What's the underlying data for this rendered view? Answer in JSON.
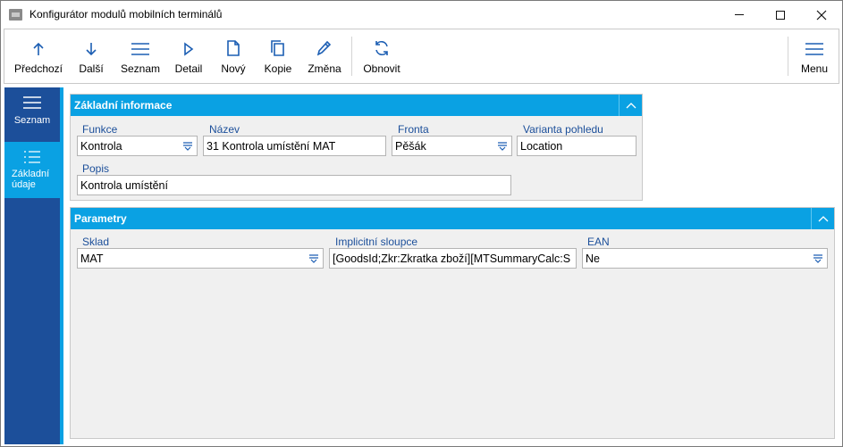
{
  "window": {
    "title": "Konfigurátor modulů mobilních terminálů",
    "icon": "app-icon",
    "controls": [
      "minimize-icon",
      "maximize-icon",
      "close-icon"
    ]
  },
  "toolbar": {
    "items": [
      {
        "label": "Předchozí",
        "icon": "arrow-up-icon"
      },
      {
        "label": "Další",
        "icon": "arrow-down-icon"
      },
      {
        "label": "Seznam",
        "icon": "list-icon"
      },
      {
        "label": "Detail",
        "icon": "play-icon"
      },
      {
        "label": "Nový",
        "icon": "new-document-icon"
      },
      {
        "label": "Kopie",
        "icon": "copy-icon"
      },
      {
        "label": "Změna",
        "icon": "pencil-icon"
      },
      {
        "label": "Obnovit",
        "icon": "refresh-icon"
      }
    ],
    "menu_label": "Menu"
  },
  "nav": {
    "items": [
      {
        "label": "Seznam",
        "icon": "list-icon"
      },
      {
        "label_line1": "Základní",
        "label_line2": "údaje",
        "icon": "details-list-icon",
        "selected": true
      }
    ]
  },
  "sections": {
    "basic": {
      "title": "Základní informace",
      "funkce_label": "Funkce",
      "funkce_value": "Kontrola",
      "nazev_label": "Název",
      "nazev_value": "31 Kontrola umístění MAT",
      "fronta_label": "Fronta",
      "fronta_value": "Pěšák",
      "varianta_label": "Varianta pohledu",
      "varianta_value": "Location",
      "popis_label": "Popis",
      "popis_value": "Kontrola umístění"
    },
    "params": {
      "title": "Parametry",
      "sklad_label": "Sklad",
      "sklad_value": "MAT",
      "sloupce_label": "Implicitní sloupce",
      "sloupce_value": "[GoodsId;Zkr:Zkratka zboží][MTSummaryCalc:S",
      "ean_label": "EAN",
      "ean_value": "Ne"
    }
  },
  "colors": {
    "accent": "#0aa1e3",
    "nav_dark": "#1c4f9a",
    "icon_blue": "#1c5eb3",
    "label_blue": "#1c4f9a",
    "panel_bg": "#f0f0f0"
  }
}
